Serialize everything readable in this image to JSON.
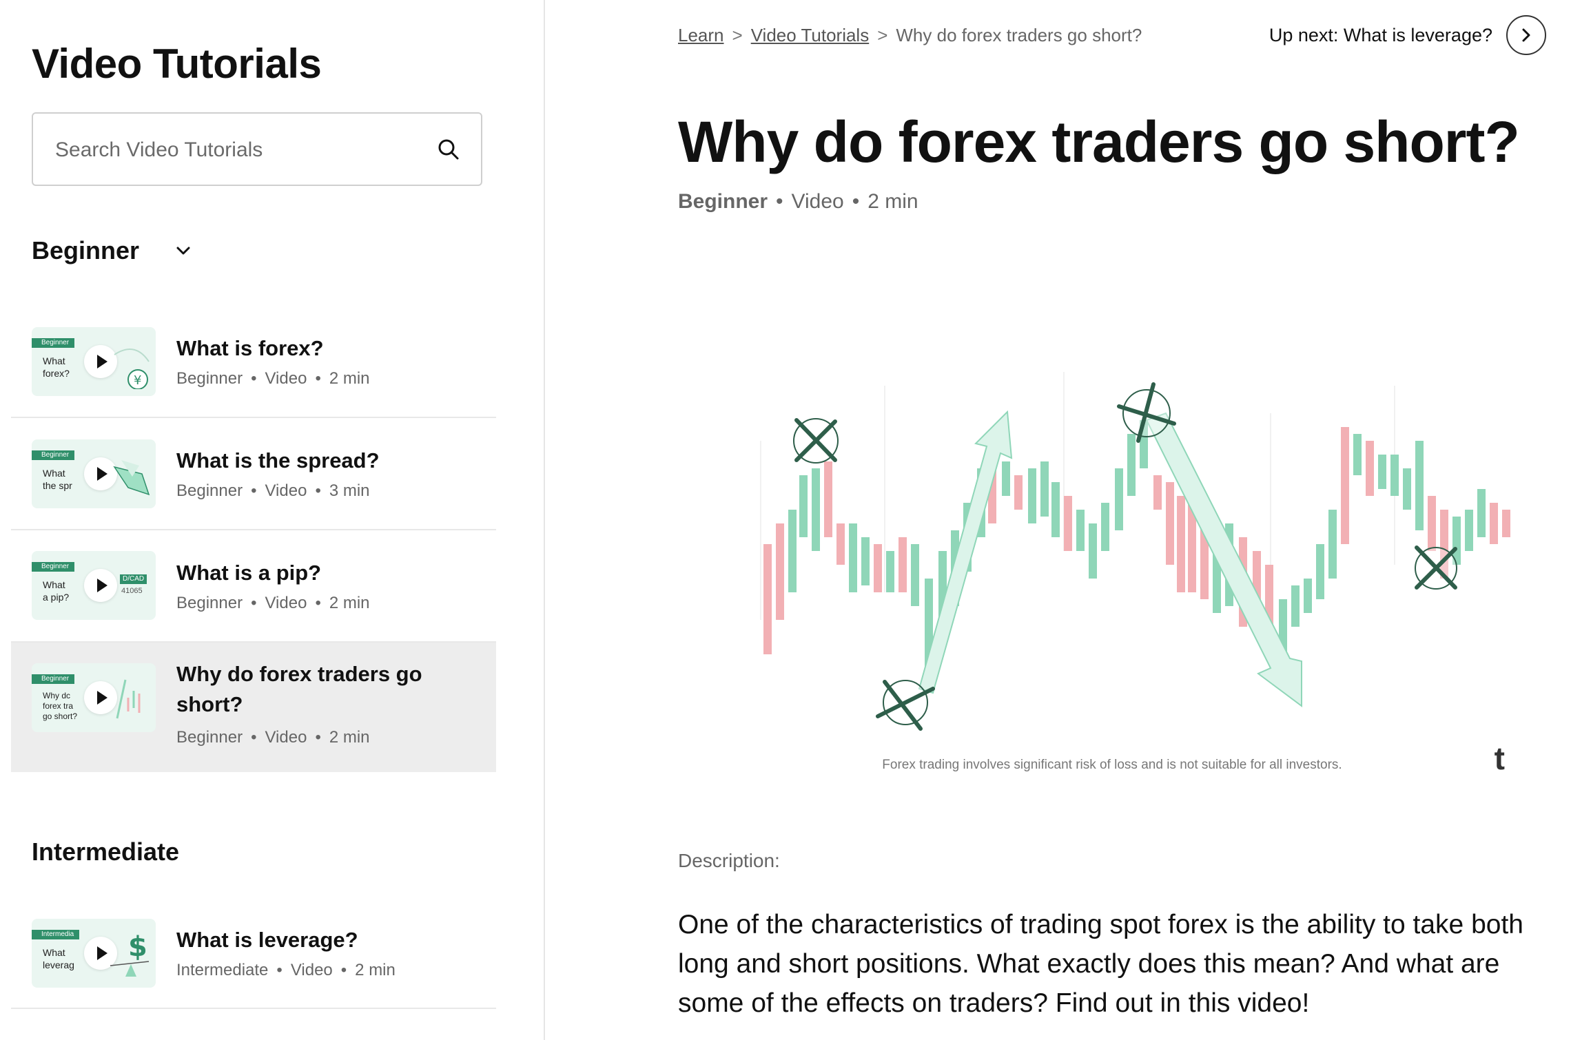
{
  "sidebar": {
    "title": "Video Tutorials",
    "search": {
      "placeholder": "Search Video Tutorials",
      "value": ""
    },
    "groups": [
      {
        "name": "Beginner",
        "items": [
          {
            "title": "What is forex?",
            "level": "Beginner",
            "type": "Video",
            "duration": "2 min",
            "thumb_tag": "Beginner",
            "thumb_text": "What\nforex?",
            "thumb_icon": "yen-coin-icon"
          },
          {
            "title": "What is the spread?",
            "level": "Beginner",
            "type": "Video",
            "duration": "3 min",
            "thumb_tag": "Beginner",
            "thumb_text": "What\nthe spr",
            "thumb_icon": "tag-icon"
          },
          {
            "title": "What is a pip?",
            "level": "Beginner",
            "type": "Video",
            "duration": "2 min",
            "thumb_tag": "Beginner",
            "thumb_text": "What\na pip?",
            "thumb_icon": "price-ticker-icon",
            "thumb_pair": "D/CAD",
            "thumb_price": "41065"
          },
          {
            "title": "Why do forex traders go short?",
            "level": "Beginner",
            "type": "Video",
            "duration": "2 min",
            "thumb_tag": "Beginner",
            "thumb_text": "Why dc\nforex tra\ngo short?",
            "thumb_icon": "chart-arrow-icon",
            "active": true
          }
        ]
      },
      {
        "name": "Intermediate",
        "items": [
          {
            "title": "What is leverage?",
            "level": "Intermediate",
            "type": "Video",
            "duration": "2 min",
            "thumb_tag": "Intermedia",
            "thumb_text": "What\nleverag",
            "thumb_icon": "dollar-scale-icon"
          }
        ]
      }
    ]
  },
  "breadcrumb": {
    "items": [
      "Learn",
      "Video Tutorials",
      "Why do forex traders go short?"
    ],
    "separator": ">"
  },
  "up_next": {
    "label": "Up next: What is leverage?"
  },
  "main": {
    "title": "Why do forex traders go short?",
    "level": "Beginner",
    "type": "Video",
    "duration": "2 min",
    "video": {
      "disclaimer": "Forex trading involves significant risk of loss and is not suitable for all investors.",
      "logo": "t"
    },
    "description_label": "Description:",
    "description": "One of the characteristics of trading spot forex is the ability to take both long and short positions. What exactly does this mean? And what are some of the effects on traders? Find out in this video!"
  },
  "colors": {
    "accent_green": "#2f8f6a",
    "candle_green": "#8fd6b8",
    "candle_red": "#f2b0b4",
    "marker": "#2e5e4a"
  }
}
